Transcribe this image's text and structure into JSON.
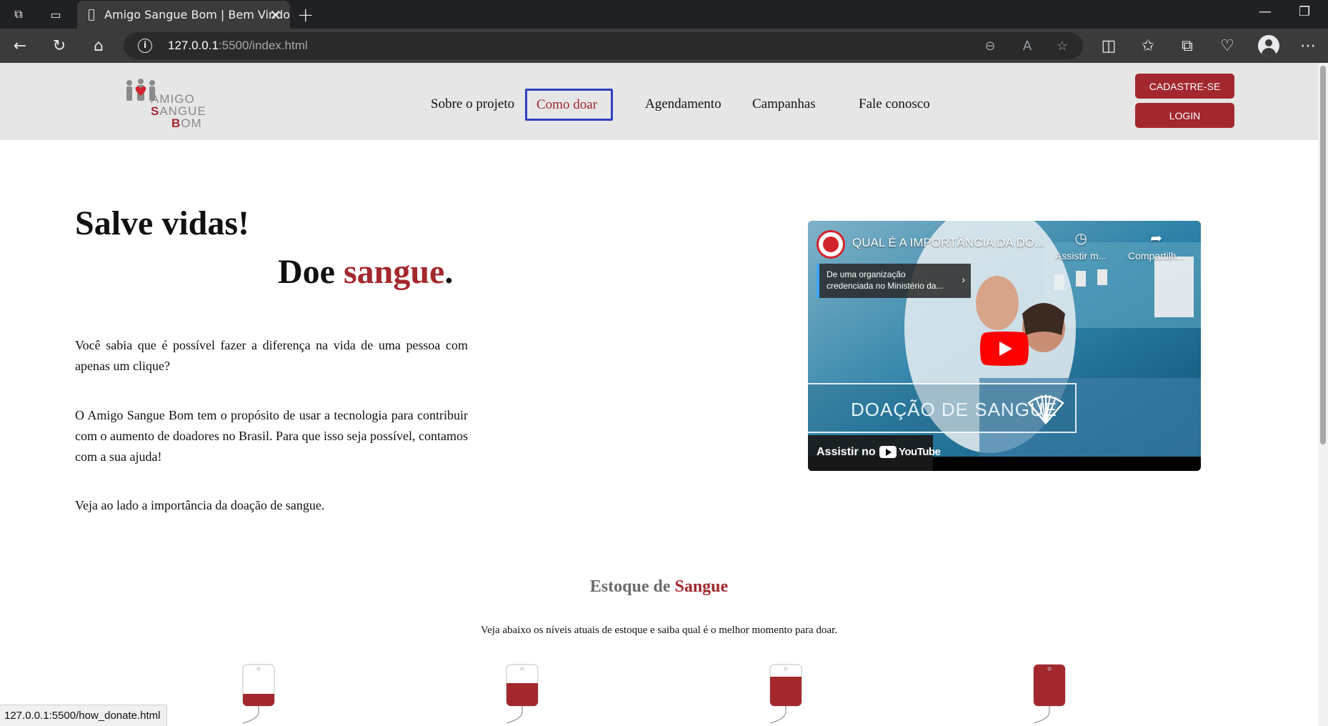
{
  "browser": {
    "tab_title": "Amigo Sangue Bom | Bem Vindo",
    "url_host": "127.0.0.1",
    "url_path": ":5500/index.html",
    "status_url": "127.0.0.1:5500/how_donate.html"
  },
  "header": {
    "logo": {
      "line1_a": "A",
      "line1_b": "MIGO",
      "line2_a": "S",
      "line2_b": "ANGUE",
      "line3_a": "B",
      "line3_b": "OM"
    },
    "nav": {
      "about": "Sobre o projeto",
      "how_donate": "Como doar",
      "schedule": "Agendamento",
      "campaigns": "Campanhas",
      "contact": "Fale conosco"
    },
    "signup_label": "CADASTRE-SE",
    "login_label": "LOGIN"
  },
  "hero": {
    "title": "Salve vidas!",
    "subtitle_a": "Doe ",
    "subtitle_b": "sangue",
    "subtitle_c": ".",
    "p1": "Você sabia que é possível fazer a diferença na vida de uma pessoa com apenas um clique?",
    "p2": "O Amigo Sangue Bom tem o propósito de usar a tecnologia para contribuir com o aumento de doadores no Brasil. Para que isso seja possível, contamos com a sua ajuda!",
    "p3": "Veja ao lado a importância da doação de sangue."
  },
  "video": {
    "title": "QUAL É A IMPORTÂNCIA DA DO...",
    "info_line1": "De uma organização",
    "info_line2": "credenciada no Ministério da...",
    "watch_later": "Assistir m...",
    "share": "Compartilh...",
    "banner": "DOAÇÃO DE SANGUE",
    "watch_on": "Assistir no",
    "youtube": "YouTube"
  },
  "stock": {
    "title_a": "Estoque de ",
    "title_b": "Sangue",
    "subtitle": "Veja abaixo os níveis atuais de estoque e saiba qual é o melhor momento para doar.",
    "levels": [
      0.3,
      0.55,
      0.7,
      1.0
    ]
  },
  "colors": {
    "brand_red": "#a3282e",
    "header_bg": "#e6e6e6",
    "focus_outline": "#3040c0"
  }
}
